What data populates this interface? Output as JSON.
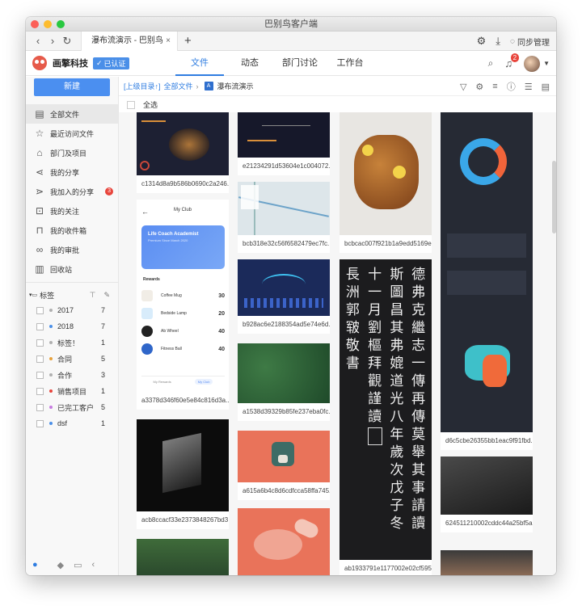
{
  "window": {
    "title": "巴别鸟客户端"
  },
  "browser": {
    "tab_title": "瀑布流演示 - 巴别鸟",
    "tab_close": "×",
    "new_tab": "+",
    "sync_label": "同步管理"
  },
  "header": {
    "company": "画擎科技",
    "verified": "已认证",
    "tabs": [
      {
        "label": "文件"
      },
      {
        "label": "动态"
      },
      {
        "label": "部门讨论"
      },
      {
        "label": "工作台"
      }
    ],
    "notifications": "2"
  },
  "sidebar": {
    "new_button": "新建",
    "items": [
      {
        "label": "全部文件",
        "icon": "drawer-icon"
      },
      {
        "label": "最近访问文件",
        "icon": "star-icon"
      },
      {
        "label": "部门及项目",
        "icon": "building-icon"
      },
      {
        "label": "我的分享",
        "icon": "share-icon"
      },
      {
        "label": "我加入的分享",
        "icon": "joined-share-icon",
        "count": "3"
      },
      {
        "label": "我的关注",
        "icon": "focus-icon"
      },
      {
        "label": "我的收件箱",
        "icon": "inbox-icon"
      },
      {
        "label": "我的审批",
        "icon": "glasses-icon"
      },
      {
        "label": "回收站",
        "icon": "trash-icon"
      }
    ],
    "tags_header": "标签",
    "tags": [
      {
        "label": "2017",
        "count": "7",
        "color": "#b0b0b0"
      },
      {
        "label": "2018",
        "count": "7",
        "color": "#4a8fe8"
      },
      {
        "label": "标签！",
        "count": "1",
        "color": "#b0b0b0"
      },
      {
        "label": "合同",
        "count": "5",
        "color": "#e8a23c"
      },
      {
        "label": "合作",
        "count": "3",
        "color": "#b0b0b0"
      },
      {
        "label": "销售项目",
        "count": "1",
        "color": "#e8453c"
      },
      {
        "label": "已完工客户",
        "count": "5",
        "color": "#c77be0"
      },
      {
        "label": "dsf",
        "count": "1",
        "color": "#4a8fe8"
      }
    ]
  },
  "toolbar": {
    "up_link": "[上级目录↑]",
    "all_files": "全部文件",
    "separator": "›",
    "folder_icon_glyph": "A",
    "current_folder": "瀑布流演示",
    "select_all": "全选"
  },
  "mockup": {
    "header": "My Club",
    "card_title": "Life Coach Academist",
    "card_sub": "Premium Since March 2020",
    "section": "Rewards",
    "products": [
      {
        "name": "Coffee Mug",
        "price": "30"
      },
      {
        "name": "Bedside Lamp",
        "price": "20"
      },
      {
        "name": "Ab Wheel",
        "price": "40"
      },
      {
        "name": "Fitness Ball",
        "price": "40"
      }
    ],
    "nav_tab_1": "My Rewards",
    "nav_tab_2": "My Club"
  },
  "calligraphy": {
    "columns": [
      "德弗克繼志一傳再傳莫舉其事請讀",
      "斯圖昌其弗媲道光八年歲次戊子冬",
      "十一月劉樞拜觀謹讀",
      "長洲郭皲敬書"
    ]
  },
  "files": [
    {
      "name": "c1314d8a9b586b0690c2a246..."
    },
    {
      "name": "e21234291d53604e1c004072..."
    },
    {
      "name": "bcbcac007f921b1a9edd5169e..."
    },
    {
      "name": "bcb318e32c56f6582479ec7fc..."
    },
    {
      "name": "a3378d346f60e5e84c816d3a..."
    },
    {
      "name": "b928ac6e2188354ad5e74e6d..."
    },
    {
      "name": "a1538d39329b85fe237eba0fc..."
    },
    {
      "name": "d6c5cbe26355bb1eac9f91fbd..."
    },
    {
      "name": "acb8ccacf33e2373848267bd3..."
    },
    {
      "name": "a615a6b4c8d6cdfcca58ffa745..."
    },
    {
      "name": "624511210002cddc44a25bf5a..."
    },
    {
      "name": "ab1933791e1177002e02cf595..."
    }
  ]
}
